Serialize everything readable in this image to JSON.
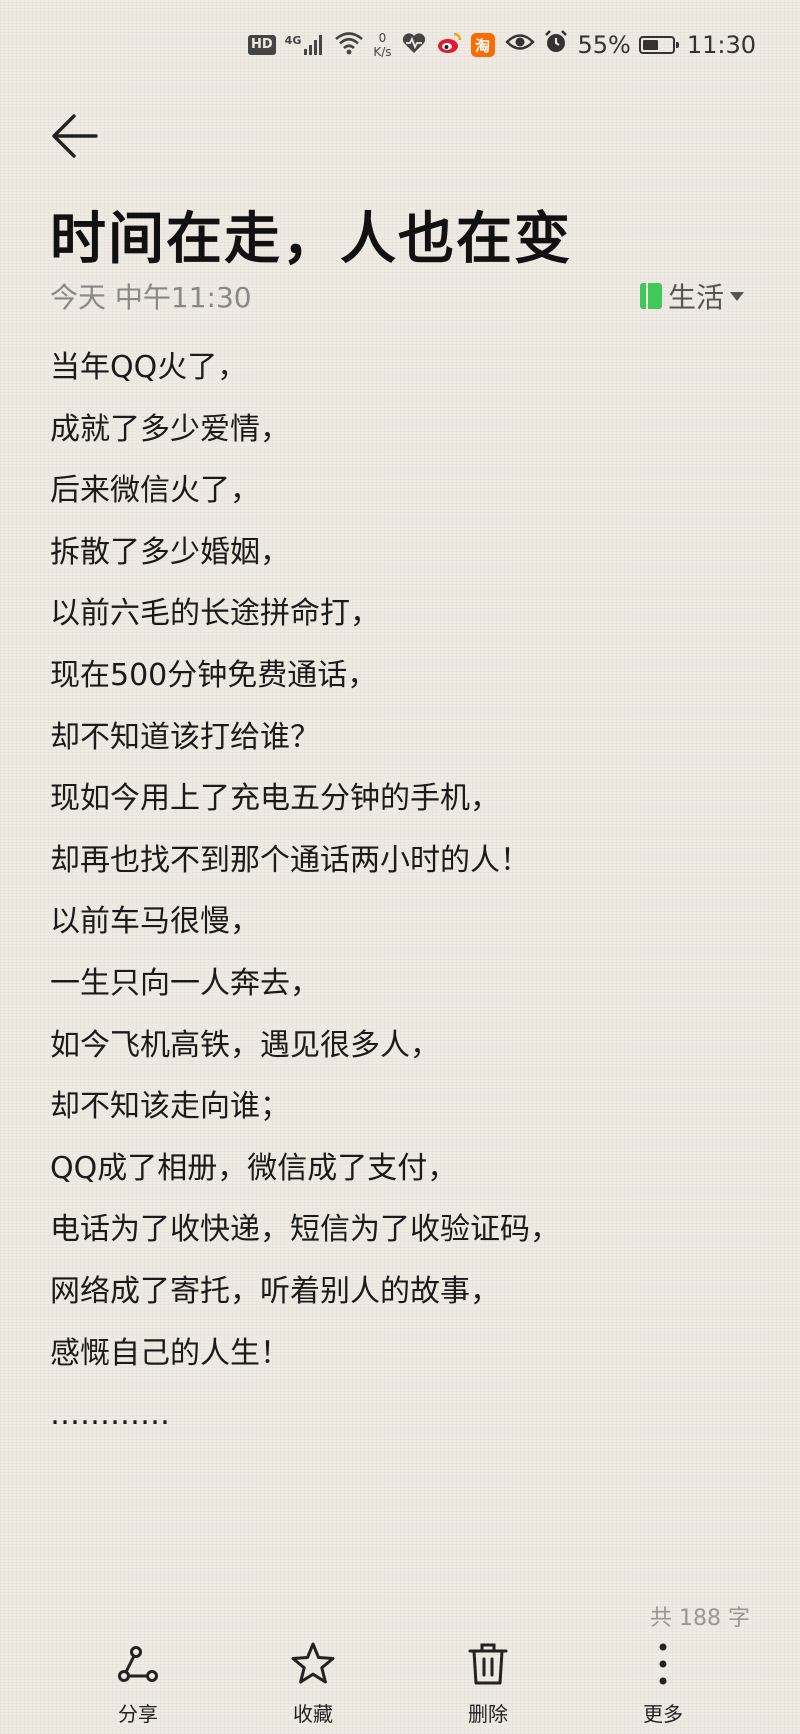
{
  "status_bar": {
    "hd": "HD",
    "signal": "4G",
    "net_speed_value": "0",
    "net_speed_unit": "K/s",
    "app_taobao": "淘",
    "battery_percent": "55%",
    "battery_level": 0.55,
    "time": "11:30"
  },
  "note": {
    "title": "时间在走，人也在变",
    "date": "今天 中午11:30",
    "category": "生活",
    "lines": [
      "当年QQ火了，",
      "成就了多少爱情，",
      "后来微信火了，",
      "拆散了多少婚姻，",
      "以前六毛的长途拼命打，",
      "现在500分钟免费通话，",
      "却不知道该打给谁？",
      "现如今用上了充电五分钟的手机，",
      "却再也找不到那个通话两小时的人！",
      "以前车马很慢，",
      "一生只向一人奔去，",
      "如今飞机高铁，遇见很多人，",
      "却不知该走向谁；",
      "QQ成了相册，微信成了支付，",
      "电话为了收快递，短信为了收验证码，",
      "网络成了寄托，听着别人的故事，",
      "感慨自己的人生！",
      "…………"
    ],
    "word_count": "共 188 字"
  },
  "toolbar": {
    "share": "分享",
    "favorite": "收藏",
    "delete": "删除",
    "more": "更多"
  },
  "colors": {
    "background": "#efebe3",
    "category_accent": "#3ec95a",
    "weibo": "#e6162d",
    "taobao": "#ff6a00"
  }
}
